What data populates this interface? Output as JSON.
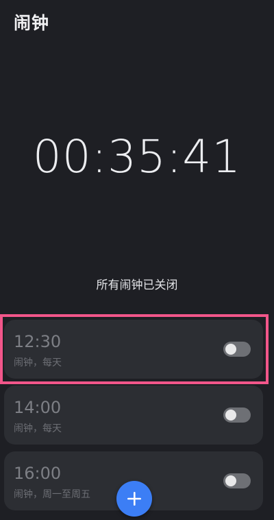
{
  "header": {
    "title": "闹钟"
  },
  "clock": {
    "time": "00:35:41"
  },
  "status": {
    "text": "所有闹钟已关闭"
  },
  "alarms": [
    {
      "time": "12:30",
      "description": "闹钟，每天",
      "enabled": false
    },
    {
      "time": "14:00",
      "description": "闹钟，每天",
      "enabled": false
    },
    {
      "time": "16:00",
      "description": "闹钟，周一至周五",
      "enabled": false
    }
  ],
  "fab": {
    "icon": "plus-icon"
  },
  "colors": {
    "background": "#1e1f24",
    "card": "#2c2e33",
    "accent": "#3c7ef5",
    "highlight": "#f2568a",
    "toggle_off": "#6e7075"
  }
}
